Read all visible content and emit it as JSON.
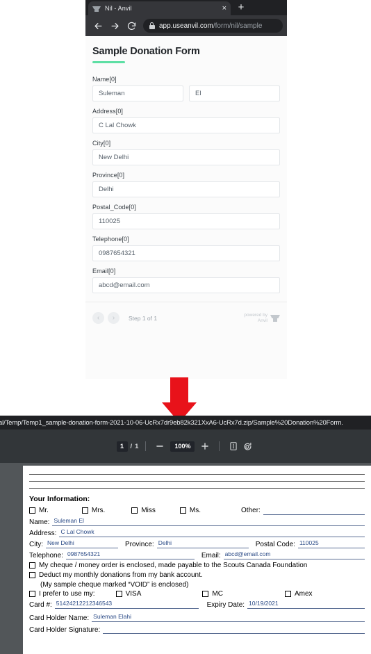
{
  "browser": {
    "tab": {
      "title": "Nil - Anvil",
      "favicon": "anvil-icon",
      "close_label": "×"
    },
    "new_tab_label": "+",
    "nav": {
      "back_icon": "back-arrow-icon",
      "forward_icon": "forward-arrow-icon",
      "reload_icon": "reload-icon",
      "lock_icon": "lock-icon",
      "url_domain": "app.useanvil.com",
      "url_path": "/form/nil/sample"
    }
  },
  "web_form": {
    "title": "Sample Donation Form",
    "accent_color": "#5ddfa4",
    "fields": [
      {
        "label": "Name[0]",
        "values": [
          "Suleman",
          "El"
        ],
        "two_column": true
      },
      {
        "label": "Address[0]",
        "values": [
          "C Lal Chowk"
        ],
        "two_column": false
      },
      {
        "label": "City[0]",
        "values": [
          "New Delhi"
        ],
        "two_column": false
      },
      {
        "label": "Province[0]",
        "values": [
          "Delhi"
        ],
        "two_column": false
      },
      {
        "label": "Postal_Code[0]",
        "values": [
          "110025"
        ],
        "two_column": false
      },
      {
        "label": "Telephone[0]",
        "values": [
          "0987654321"
        ],
        "two_column": false
      },
      {
        "label": "Email[0]",
        "values": [
          "abcd@email.com"
        ],
        "two_column": false
      }
    ],
    "footer": {
      "prev_icon": "‹",
      "next_icon": "›",
      "step_text": "Step 1 of 1",
      "powered_by": "powered by\nAnvil"
    }
  },
  "annotation": {
    "arrow_color": "#e8121a",
    "arrow_direction": "down"
  },
  "file_url": "al/Temp/Temp1_sample-donation-form-2021-10-06-UcRx7dr9eb82k321XxA6-UcRx7d.zip/Sample%20Donation%20Form.",
  "pdf_toolbar": {
    "current_page": "1",
    "separator": "/",
    "total_pages": "1",
    "zoom_out_icon": "minus-icon",
    "zoom_level": "100%",
    "zoom_in_icon": "plus-icon",
    "fit_page_icon": "fit-page-icon",
    "rotate_icon": "rotate-icon"
  },
  "pdf_document": {
    "section_heading": "Your Information:",
    "title_checkboxes": [
      "Mr.",
      "Mrs.",
      "Miss",
      "Ms."
    ],
    "other_label": "Other:",
    "other_value": "",
    "name_label": "Name:",
    "name_value": "Suleman El",
    "address_label": "Address:",
    "address_value": "C Lal Chowk",
    "city_label": "City:",
    "city_value": "New Delhi",
    "province_label": "Province:",
    "province_value": "Delhi",
    "postal_label": "Postal Code:",
    "postal_value": "110025",
    "telephone_label": "Telephone:",
    "telephone_value": "0987654321",
    "email_label": "Email:",
    "email_value": "abcd@email.com",
    "cheque_option": "My cheque / money order is enclosed, made payable to the Scouts Canada Foundation",
    "deduct_option": "Deduct my monthly donations from my bank account.",
    "void_note": "(My sample cheque marked “VOID” is enclosed)",
    "prefer_label": "I prefer to use my:",
    "card_types": [
      "VISA",
      "MC",
      "Amex"
    ],
    "card_number_label": "Card #:",
    "card_number_value": "51424212212346543",
    "expiry_label": "Expiry Date:",
    "expiry_value": "10/19/2021",
    "holder_name_label": "Card Holder Name:",
    "holder_name_value": "Suleman Elahi",
    "signature_label": "Card Holder Signature:",
    "signature_value": ""
  }
}
